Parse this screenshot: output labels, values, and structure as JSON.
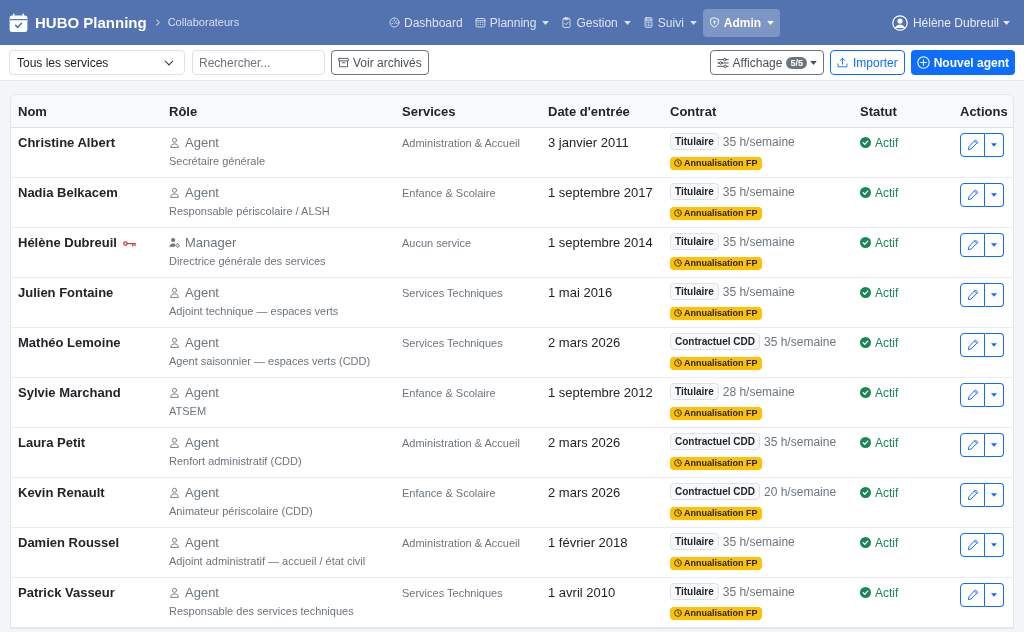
{
  "navbar": {
    "brand": "HUBO Planning",
    "breadcrumb": "Collaborateurs",
    "menu": [
      {
        "label": "Dashboard",
        "dropdown": false,
        "selected": false
      },
      {
        "label": "Planning",
        "dropdown": true,
        "selected": false
      },
      {
        "label": "Gestion",
        "dropdown": true,
        "selected": false
      },
      {
        "label": "Suivi",
        "dropdown": true,
        "selected": false
      },
      {
        "label": "Admin",
        "dropdown": true,
        "selected": true
      }
    ],
    "user": {
      "label": "Hélène Dubreuil",
      "dropdown": true
    }
  },
  "toolbar": {
    "service_filter": {
      "value": "Tous les services"
    },
    "search": {
      "placeholder": "Rechercher..."
    },
    "archive_button": "Voir archivés",
    "display_button": {
      "label": "Affichage",
      "badge": "5/5"
    },
    "import_button": "Importer",
    "new_button": "Nouvel agent"
  },
  "table": {
    "columns": [
      "Nom",
      "Rôle",
      "Services",
      "Date d'entrée",
      "Contrat",
      "Statut",
      "Actions"
    ],
    "rows": [
      {
        "name": "Christine Albert",
        "key": false,
        "role": {
          "kind": "agent",
          "label": "Agent"
        },
        "position": "Secrétaire générale",
        "services": "Administration & Accueil",
        "date": "3 janvier 2011",
        "contract": {
          "type": "Titulaire",
          "hours": "35 h/semaine",
          "tag": "Annualisation FP"
        },
        "status": {
          "kind": "active",
          "label": "Actif"
        }
      },
      {
        "name": "Nadia Belkacem",
        "key": false,
        "role": {
          "kind": "agent",
          "label": "Agent"
        },
        "position": "Responsable périscolaire / ALSH",
        "services": "Enfance & Scolaire",
        "date": "1 septembre 2017",
        "contract": {
          "type": "Titulaire",
          "hours": "35 h/semaine",
          "tag": "Annualisation FP"
        },
        "status": {
          "kind": "active",
          "label": "Actif"
        }
      },
      {
        "name": "Hélène Dubreuil",
        "key": true,
        "role": {
          "kind": "manager",
          "label": "Manager"
        },
        "position": "Directrice générale des services",
        "services": "Aucun service",
        "date": "1 septembre 2014",
        "contract": {
          "type": "Titulaire",
          "hours": "35 h/semaine",
          "tag": "Annualisation FP"
        },
        "status": {
          "kind": "active",
          "label": "Actif"
        }
      },
      {
        "name": "Julien Fontaine",
        "key": false,
        "role": {
          "kind": "agent",
          "label": "Agent"
        },
        "position": "Adjoint technique — espaces verts",
        "services": "Services Techniques",
        "date": "1 mai 2016",
        "contract": {
          "type": "Titulaire",
          "hours": "35 h/semaine",
          "tag": "Annualisation FP"
        },
        "status": {
          "kind": "active",
          "label": "Actif"
        }
      },
      {
        "name": "Mathéo Lemoine",
        "key": false,
        "role": {
          "kind": "agent",
          "label": "Agent"
        },
        "position": "Agent saisonnier — espaces verts (CDD)",
        "services": "Services Techniques",
        "date": "2 mars 2026",
        "contract": {
          "type": "Contractuel CDD",
          "hours": "35 h/semaine",
          "tag": "Annualisation FP"
        },
        "status": {
          "kind": "active",
          "label": "Actif"
        }
      },
      {
        "name": "Sylvie Marchand",
        "key": false,
        "role": {
          "kind": "agent",
          "label": "Agent"
        },
        "position": "ATSEM",
        "services": "Enfance & Scolaire",
        "date": "1 septembre 2012",
        "contract": {
          "type": "Titulaire",
          "hours": "28 h/semaine",
          "tag": "Annualisation FP"
        },
        "status": {
          "kind": "active",
          "label": "Actif"
        }
      },
      {
        "name": "Laura Petit",
        "key": false,
        "role": {
          "kind": "agent",
          "label": "Agent"
        },
        "position": "Renfort administratif (CDD)",
        "services": "Administration & Accueil",
        "date": "2 mars 2026",
        "contract": {
          "type": "Contractuel CDD",
          "hours": "35 h/semaine",
          "tag": "Annualisation FP"
        },
        "status": {
          "kind": "active",
          "label": "Actif"
        }
      },
      {
        "name": "Kevin Renault",
        "key": false,
        "role": {
          "kind": "agent",
          "label": "Agent"
        },
        "position": "Animateur périscolaire (CDD)",
        "services": "Enfance & Scolaire",
        "date": "2 mars 2026",
        "contract": {
          "type": "Contractuel CDD",
          "hours": "20 h/semaine",
          "tag": "Annualisation FP"
        },
        "status": {
          "kind": "active",
          "label": "Actif"
        }
      },
      {
        "name": "Damien Roussel",
        "key": false,
        "role": {
          "kind": "agent",
          "label": "Agent"
        },
        "position": "Adjoint administratif — accueil / état civil",
        "services": "Administration & Accueil",
        "date": "1 février 2018",
        "contract": {
          "type": "Titulaire",
          "hours": "35 h/semaine",
          "tag": "Annualisation FP"
        },
        "status": {
          "kind": "active",
          "label": "Actif"
        }
      },
      {
        "name": "Patrick Vasseur",
        "key": false,
        "role": {
          "kind": "agent",
          "label": "Agent"
        },
        "position": "Responsable des services techniques",
        "services": "Services Techniques",
        "date": "1 avril 2010",
        "contract": {
          "type": "Titulaire",
          "hours": "35 h/semaine",
          "tag": "Annualisation FP"
        },
        "status": {
          "kind": "active",
          "label": "Actif"
        }
      }
    ]
  }
}
